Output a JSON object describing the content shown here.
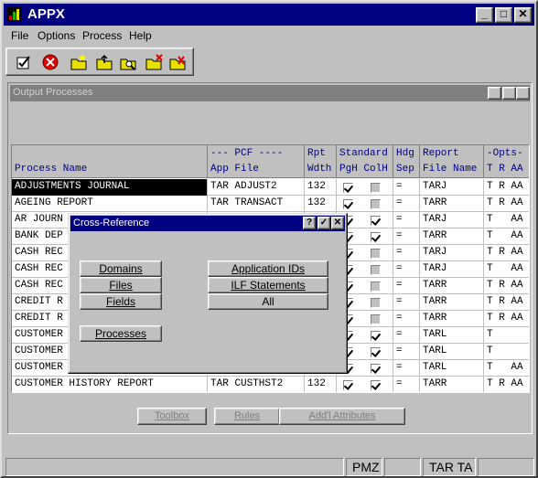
{
  "window": {
    "title": "APPX"
  },
  "menu": [
    "File",
    "Options",
    "Process",
    "Help"
  ],
  "toolbar": [
    "checkmark-doc-icon",
    "cancel-icon",
    "folder-new-icon",
    "folder-up-icon",
    "folder-search-icon",
    "folder-close-icon",
    "folder-check-icon"
  ],
  "output_processes": {
    "title": "Output Processes",
    "headers": {
      "name": [
        "",
        "Process Name"
      ],
      "pcf": [
        "--- PCF ----",
        "App File"
      ],
      "rpt": [
        "Rpt",
        "Wdth"
      ],
      "std": [
        "Standard",
        "PgH ColH"
      ],
      "hdg": [
        "Hdg",
        "Sep"
      ],
      "report": [
        "Report",
        "File Name"
      ],
      "opts": [
        "-Opts-",
        "T R AA"
      ]
    },
    "rows": [
      {
        "name": "ADJUSTMENTS JOURNAL",
        "pcf": "TAR ADJUST2",
        "rpt": "132",
        "pgh": true,
        "colh": false,
        "sep": "=",
        "file": "TARJ",
        "opts": "T R AA"
      },
      {
        "name": "AGEING REPORT",
        "pcf": "TAR TRANSACT",
        "rpt": "132",
        "pgh": true,
        "colh": false,
        "sep": "=",
        "file": "TARR",
        "opts": "T R AA"
      },
      {
        "name": "AR JOURN",
        "pcf": "",
        "rpt": "",
        "pgh": true,
        "colh": true,
        "sep": "=",
        "file": "TARJ",
        "opts": "T   AA"
      },
      {
        "name": "BANK DEP",
        "pcf": "",
        "rpt": "",
        "pgh": true,
        "colh": true,
        "sep": "=",
        "file": "TARR",
        "opts": "T   AA"
      },
      {
        "name": "CASH REC",
        "pcf": "",
        "rpt": "",
        "pgh": true,
        "colh": false,
        "sep": "=",
        "file": "TARJ",
        "opts": "T R AA"
      },
      {
        "name": "CASH REC",
        "pcf": "",
        "rpt": "",
        "pgh": true,
        "colh": false,
        "sep": "=",
        "file": "TARJ",
        "opts": "T   AA"
      },
      {
        "name": "CASH REC",
        "pcf": "",
        "rpt": "",
        "pgh": true,
        "colh": false,
        "sep": "=",
        "file": "TARR",
        "opts": "T R AA"
      },
      {
        "name": "CREDIT R",
        "pcf": "",
        "rpt": "",
        "pgh": true,
        "colh": false,
        "sep": "=",
        "file": "TARR",
        "opts": "T R AA"
      },
      {
        "name": "CREDIT R",
        "pcf": "",
        "rpt": "",
        "pgh": true,
        "colh": false,
        "sep": "=",
        "file": "TARR",
        "opts": "T R AA"
      },
      {
        "name": "CUSTOMER",
        "pcf": "",
        "rpt": "",
        "pgh": true,
        "colh": true,
        "sep": "=",
        "file": "TARL",
        "opts": "T"
      },
      {
        "name": "CUSTOMER",
        "pcf": "",
        "rpt": "",
        "pgh": true,
        "colh": true,
        "sep": "=",
        "file": "TARL",
        "opts": "T"
      },
      {
        "name": "CUSTOMER",
        "pcf": "",
        "rpt": "",
        "pgh": true,
        "colh": true,
        "sep": "=",
        "file": "TARL",
        "opts": "T   AA"
      },
      {
        "name": "CUSTOMER HISTORY REPORT",
        "pcf": "TAR CUSTHST2",
        "rpt": "132",
        "pgh": true,
        "colh": true,
        "sep": "=",
        "file": "TARR",
        "opts": "T R AA"
      }
    ],
    "buttons": {
      "toolbox": "Toolbox",
      "rules": "Rules",
      "attributes": "Add'l Attributes"
    }
  },
  "xref": {
    "title": "Cross-Reference",
    "domains": "Domains",
    "files": "Files",
    "fields": "Fields",
    "processes": "Processes",
    "app_ids": "Application IDs",
    "ilf": "ILF Statements",
    "all": "All"
  },
  "status": {
    "user": "PMZ",
    "app": "TAR TA"
  }
}
